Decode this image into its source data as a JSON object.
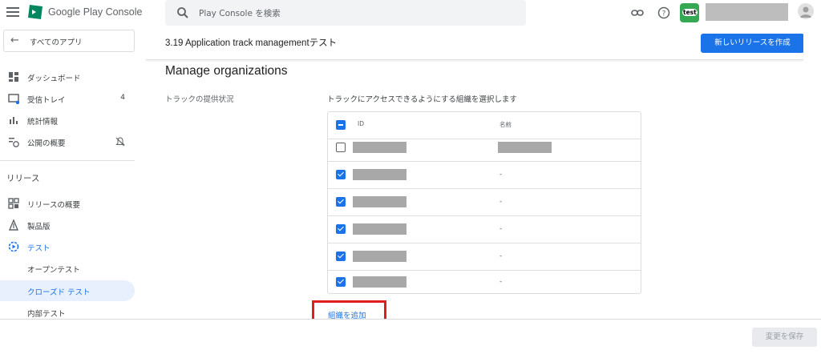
{
  "brand": {
    "name": "Google Play Console"
  },
  "sidebar": {
    "back_label": "すべてのアプリ",
    "items": [
      {
        "label": "ダッシュボード",
        "icon": "dashboard-icon"
      },
      {
        "label": "受信トレイ",
        "badge": "4",
        "icon": "inbox-icon"
      },
      {
        "label": "統計情報",
        "icon": "statistics-icon"
      },
      {
        "label": "公開の概要",
        "icon": "publishing-overview-icon"
      }
    ],
    "section_label": "リリース",
    "release_items": [
      {
        "label": "リリースの概要",
        "icon": "releases-overview-icon"
      },
      {
        "label": "製品版",
        "icon": "production-icon"
      },
      {
        "label": "テスト",
        "icon": "testing-icon"
      },
      {
        "label": "オープンテスト"
      },
      {
        "label": "クローズド テスト"
      },
      {
        "label": "内部テスト"
      }
    ]
  },
  "search": {
    "placeholder": "Play Console を検索"
  },
  "avatar": {
    "label": "test"
  },
  "header": {
    "app_title": "3.19 Application track managementテスト",
    "create_release_label": "新しいリリースを作成"
  },
  "main": {
    "section_title": "Manage organizations",
    "availability_label": "トラックの提供状況",
    "availability_desc": "トラックにアクセスできるようにする組織を選択します",
    "table": {
      "col_id": "ID",
      "col_name": "名前",
      "rows": [
        {
          "checked": false,
          "name": ""
        },
        {
          "checked": true,
          "name": "-"
        },
        {
          "checked": true,
          "name": "-"
        },
        {
          "checked": true,
          "name": "-"
        },
        {
          "checked": true,
          "name": "-"
        },
        {
          "checked": true,
          "name": "-"
        }
      ]
    },
    "add_org_label": "組織を追加"
  },
  "footer": {
    "save_label": "変更を保存"
  },
  "colors": {
    "accent": "#1a73e8",
    "highlight_border": "#e01e1e",
    "active_bg": "#e8f0fe"
  }
}
